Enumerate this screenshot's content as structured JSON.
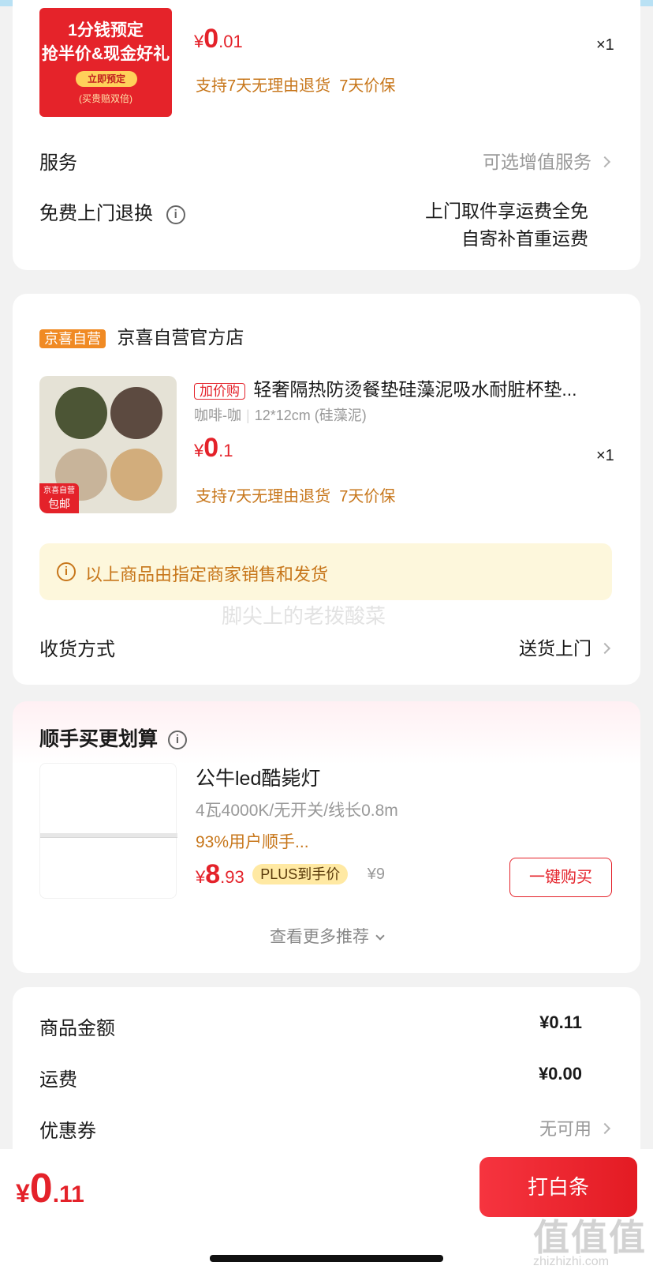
{
  "colors": {
    "accent": "#e4222a",
    "orange_text": "#c7761a",
    "self_tag": "#f08a24",
    "notice_bg": "#fdf7dc"
  },
  "item1": {
    "image": {
      "line1": "1分钱预定",
      "line2": "抢半价&现金好礼",
      "button": "立即预定",
      "note": "(买贵赔双倍)"
    },
    "price_symbol": "¥",
    "price_int": "0",
    "price_dec": ".01",
    "quantity": "×1",
    "guarantees": "支持7天无理由退货  7天价保"
  },
  "service": {
    "label": "服务",
    "value": "可选增值服务",
    "return_label": "免费上门退换",
    "return_line1": "上门取件享运费全免",
    "return_line2": "自寄补首重运费"
  },
  "store": {
    "tag": "京喜自营",
    "name": "京喜自营官方店",
    "item": {
      "tag": "加价购",
      "title": "轻奢隔热防烫餐垫硅藻泥吸水耐脏杯垫...",
      "spec_a": "咖啡-咖",
      "spec_b": "12*12cm (硅藻泥)",
      "image_badge_line1": "京喜自营",
      "image_badge_line2": "包邮",
      "price_symbol": "¥",
      "price_int": "0",
      "price_dec": ".1",
      "quantity": "×1",
      "guarantees": "支持7天无理由退货  7天价保"
    },
    "notice": "以上商品由指定商家销售和发货",
    "watermark": "脚尖上的老拨酸菜",
    "delivery_label": "收货方式",
    "delivery_value": "送货上门"
  },
  "recommend": {
    "title": "顺手买更划算",
    "product_name": "公牛led酷毙灯",
    "product_spec": "4瓦4000K/无开关/线长0.8m",
    "product_note": "93%用户顺手...",
    "price_symbol": "¥",
    "price_int": "8",
    "price_dec": ".93",
    "plus_label": "PLUS到手价",
    "original_price": "¥9",
    "buy_button": "一键购买",
    "more": "查看更多推荐"
  },
  "summary": {
    "rows": [
      {
        "label": "商品金额",
        "value": "¥0.11"
      },
      {
        "label": "运费",
        "value": "¥0.00"
      },
      {
        "label": "优惠券",
        "value": "无可用"
      }
    ]
  },
  "bottom": {
    "price_symbol": "¥",
    "price_int": "0",
    "price_dec": ".11",
    "pay_button": "打白条",
    "site_logo": "值值值",
    "site_url": "zhizhizhi.com"
  }
}
